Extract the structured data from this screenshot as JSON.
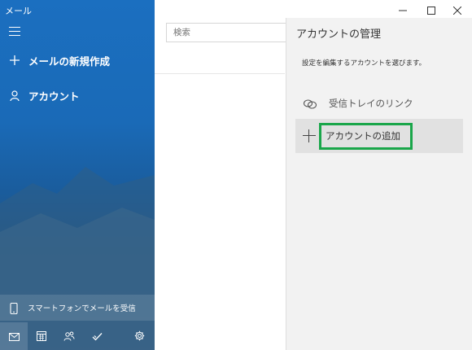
{
  "app": {
    "title": "メール"
  },
  "nav": {
    "new_mail_label": "メールの新規作成",
    "account_label": "アカウント",
    "phone_promo_label": "スマートフォンでメールを受信",
    "bottom_icons": [
      "mail-icon",
      "calendar-icon",
      "people-icon",
      "todo-icon",
      "gear-icon"
    ]
  },
  "search": {
    "placeholder": "検索"
  },
  "flyout": {
    "title": "アカウントの管理",
    "subtitle": "設定を編集するアカウントを選びます。",
    "link_inboxes_label": "受信トレイのリンク",
    "add_account_label": "アカウントの追加"
  },
  "colors": {
    "nav_blue": "#1b6fc0",
    "highlight_green": "#1aa64a",
    "flyout_bg": "#f2f2f2"
  }
}
